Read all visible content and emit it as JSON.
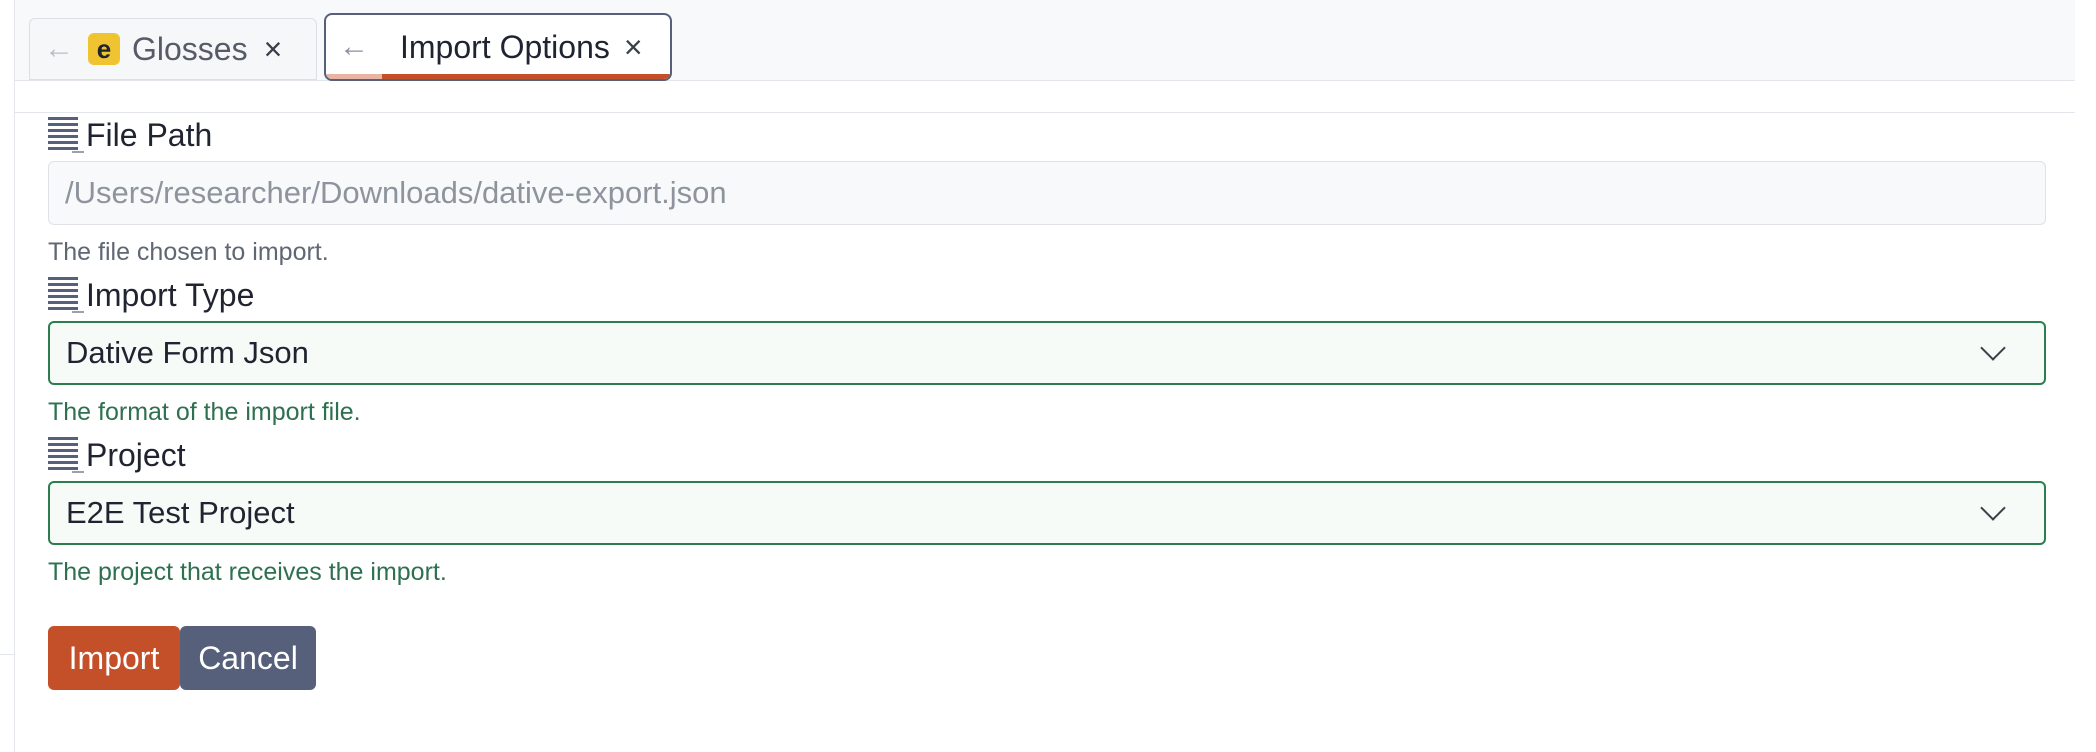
{
  "tabs": [
    {
      "label": "Glosses",
      "badge": "e",
      "close": "×",
      "back": "←"
    },
    {
      "label": "Import Options",
      "close": "×",
      "back": "←"
    }
  ],
  "form": {
    "file_path": {
      "label": "File Path",
      "value": "/Users/researcher/Downloads/dative-export.json",
      "help": "The file chosen to import."
    },
    "import_type": {
      "label": "Import Type",
      "value": "Dative Form Json",
      "help": "The format of the import file."
    },
    "project": {
      "label": "Project",
      "value": "E2E Test Project",
      "help": "The project that receives the import."
    }
  },
  "actions": {
    "import_label": "Import",
    "cancel_label": "Cancel"
  },
  "colors": {
    "accent": "#c4502a",
    "secondary": "#56607a",
    "valid": "#2e7d4f",
    "badge": "#f0c330"
  },
  "icons": [
    "back-arrow-icon",
    "close-icon",
    "field-lines-icon",
    "chevron-down-icon"
  ]
}
